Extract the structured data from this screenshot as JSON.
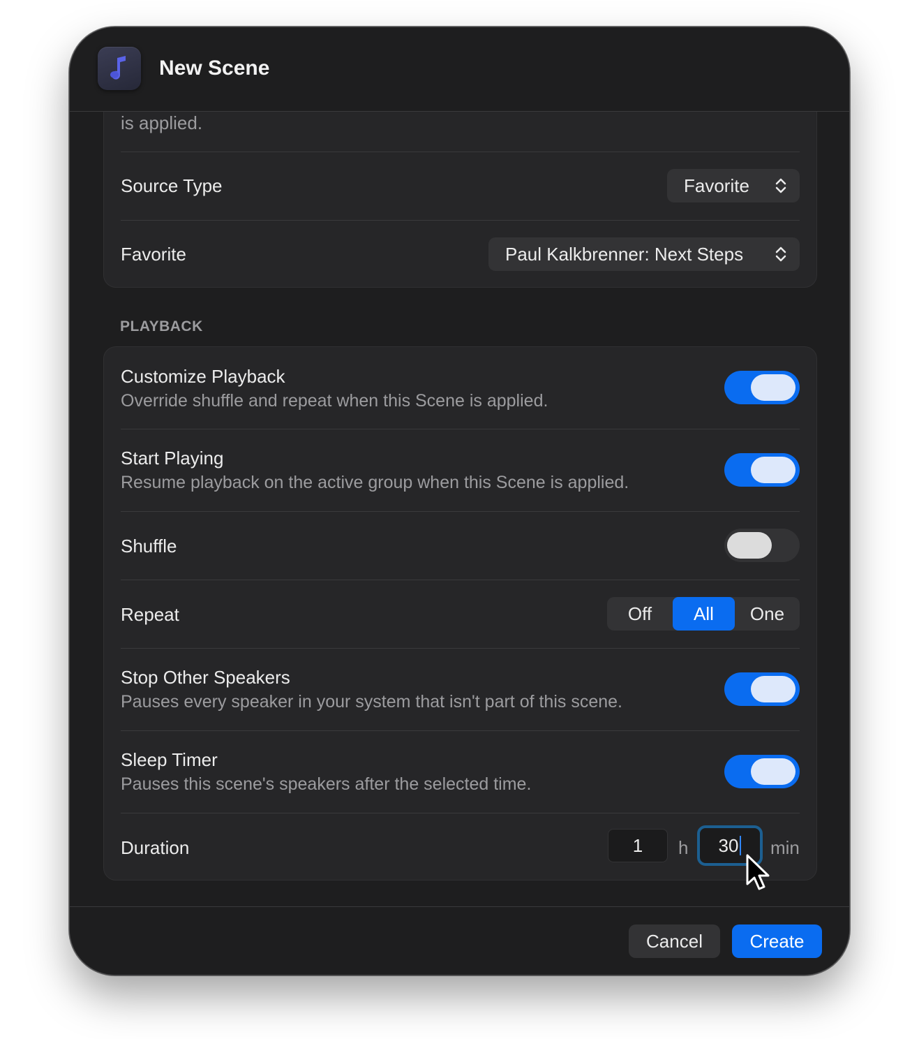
{
  "window": {
    "title": "New Scene",
    "app_icon": "music-note-icon"
  },
  "top_card": {
    "partial_text": "is applied.",
    "rows": [
      {
        "label": "Source Type",
        "value": "Favorite"
      },
      {
        "label": "Favorite",
        "value": "Paul Kalkbrenner: Next Steps"
      }
    ]
  },
  "playback": {
    "section_label": "PLAYBACK",
    "customize": {
      "title": "Customize Playback",
      "subtitle": "Override shuffle and repeat when this Scene is applied.",
      "on": true
    },
    "start_playing": {
      "title": "Start Playing",
      "subtitle": "Resume playback on the active group when this Scene is applied.",
      "on": true
    },
    "shuffle": {
      "title": "Shuffle",
      "on": false
    },
    "repeat": {
      "title": "Repeat",
      "options": [
        "Off",
        "All",
        "One"
      ],
      "selected": "All"
    },
    "stop_others": {
      "title": "Stop Other Speakers",
      "subtitle": "Pauses every speaker in your system that isn't part of this scene.",
      "on": true
    },
    "sleep_timer": {
      "title": "Sleep Timer",
      "subtitle": "Pauses this scene's speakers after the selected time.",
      "on": true
    },
    "duration": {
      "title": "Duration",
      "hours": "1",
      "hours_unit": "h",
      "minutes": "30",
      "minutes_unit": "min"
    }
  },
  "footer": {
    "cancel_label": "Cancel",
    "create_label": "Create"
  },
  "colors": {
    "accent": "#0a6cf0",
    "window_bg": "#1e1e1f",
    "card_bg": "#262628",
    "focus_ring": "#1c5f91"
  }
}
